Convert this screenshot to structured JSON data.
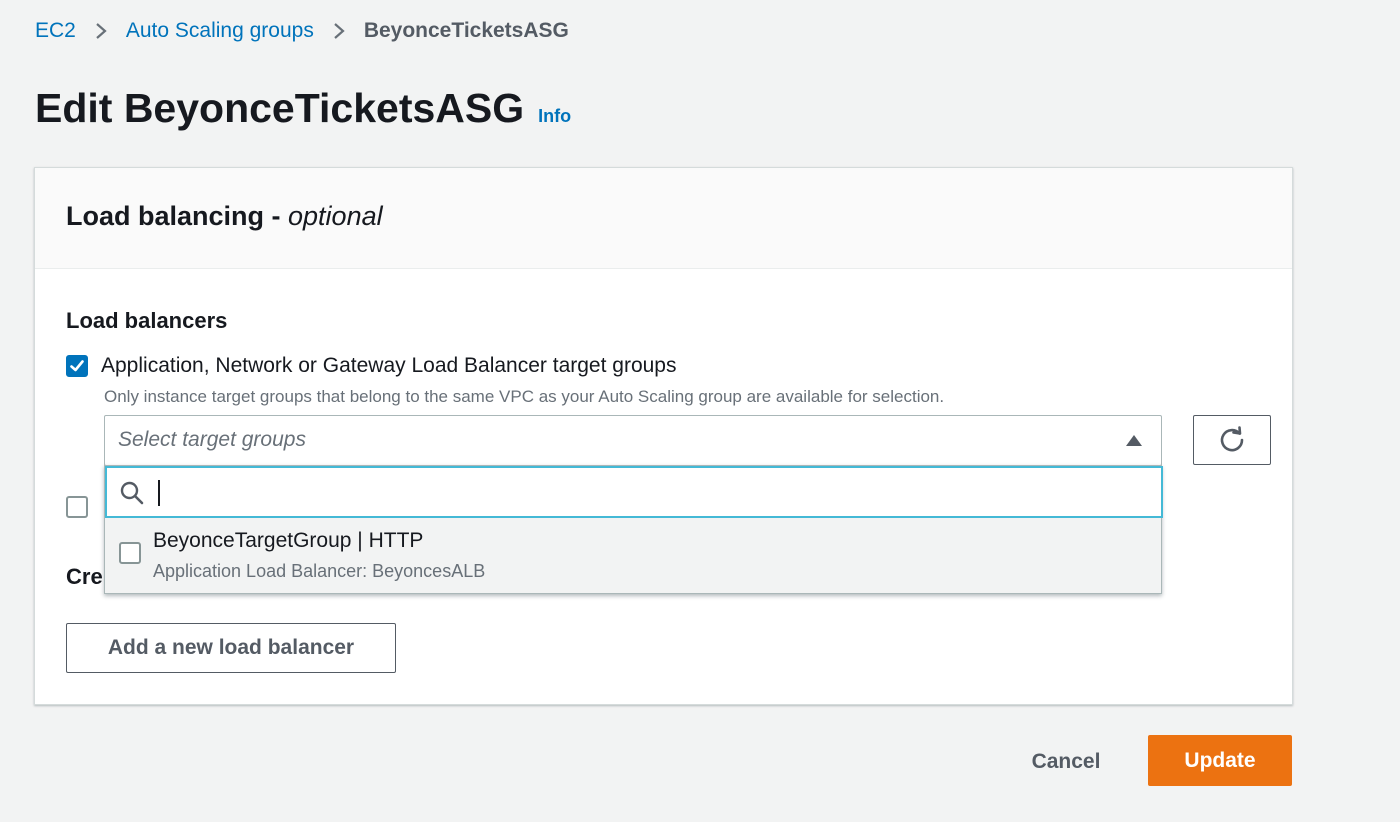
{
  "breadcrumb": {
    "items": [
      {
        "label": "EC2"
      },
      {
        "label": "Auto Scaling groups"
      }
    ],
    "current": "BeyonceTicketsASG"
  },
  "page": {
    "title": "Edit BeyonceTicketsASG",
    "info_label": "Info"
  },
  "load_balancing": {
    "title": "Load balancing - ",
    "title_suffix": "optional",
    "section_label": "Load balancers",
    "target_groups_option": {
      "label": "Application, Network or Gateway Load Balancer target groups",
      "checked": true,
      "description": "Only instance target groups that belong to the same VPC as your Auto Scaling group are available for selection."
    },
    "select": {
      "placeholder": "Select target groups",
      "filter_value": ""
    },
    "options": [
      {
        "label": "BeyonceTargetGroup | HTTP",
        "description": "Application Load Balancer: BeyoncesALB",
        "checked": false
      }
    ],
    "second_option_checked": false,
    "partial_label": "Cre",
    "add_button_label": "Add a new load balancer"
  },
  "footer": {
    "cancel_label": "Cancel",
    "update_label": "Update"
  },
  "colors": {
    "link": "#0073bb",
    "primary": "#ec7211",
    "focus": "#44b9d6",
    "checkbox_checked": "#0073bb"
  },
  "icons": {
    "breadcrumb_separator": "chevron-right-icon",
    "refresh": "refresh-icon",
    "search": "search-icon",
    "dropdown_caret": "caret-up-icon",
    "checkmark": "checkmark-icon"
  }
}
